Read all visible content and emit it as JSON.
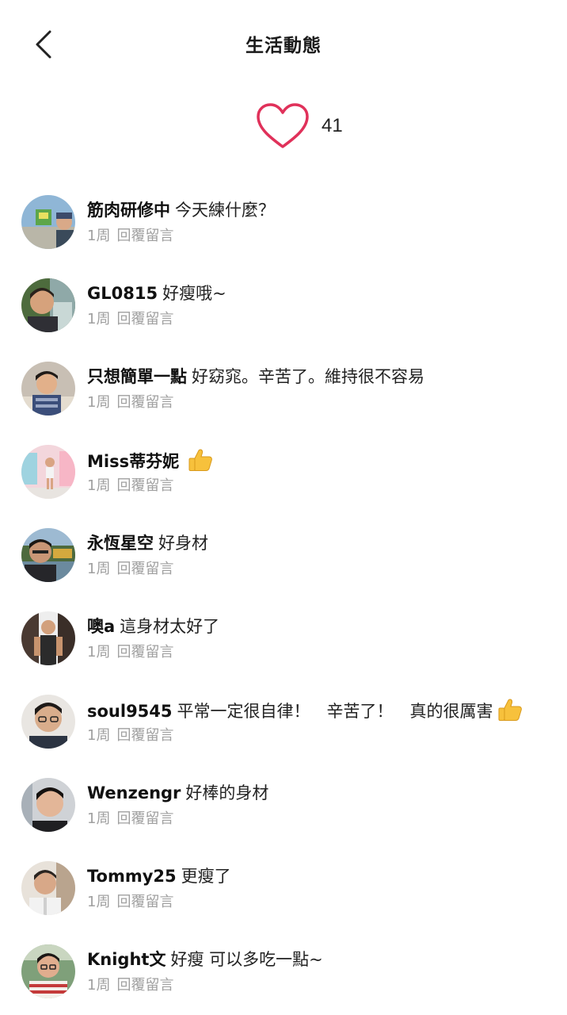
{
  "header": {
    "title": "生活動態",
    "back_icon": "chevron-left-icon"
  },
  "likes": {
    "icon": "heart-outline-icon",
    "count": "41",
    "heart_color": "#e0315a"
  },
  "reply_label": "回覆留言",
  "comments": [
    {
      "username": "筋肉研修中",
      "text": "今天練什麼？",
      "time": "1周",
      "thumb": false
    },
    {
      "username": "GL0815",
      "text": "好瘦哦~",
      "time": "1周",
      "thumb": false
    },
    {
      "username": "只想簡單一點",
      "text": "好窈窕。辛苦了。維持很不容易",
      "time": "1周",
      "thumb": false
    },
    {
      "username": "Miss蒂芬妮",
      "text": "",
      "time": "1周",
      "thumb": true
    },
    {
      "username": "永恆星空",
      "text": "好身材",
      "time": "1周",
      "thumb": false
    },
    {
      "username": "噢a",
      "text": "這身材太好了",
      "time": "1周",
      "thumb": false
    },
    {
      "username": "soul9545",
      "text": "平常一定很自律！　辛苦了！　真的很厲害",
      "time": "1周",
      "thumb": true
    },
    {
      "username": "Wenzengr",
      "text": "好棒的身材",
      "time": "1周",
      "thumb": false
    },
    {
      "username": "Tommy25",
      "text": "更瘦了",
      "time": "1周",
      "thumb": false
    },
    {
      "username": "Knight文",
      "text": "好瘦 可以多吃一點~",
      "time": "1周",
      "thumb": false
    }
  ]
}
